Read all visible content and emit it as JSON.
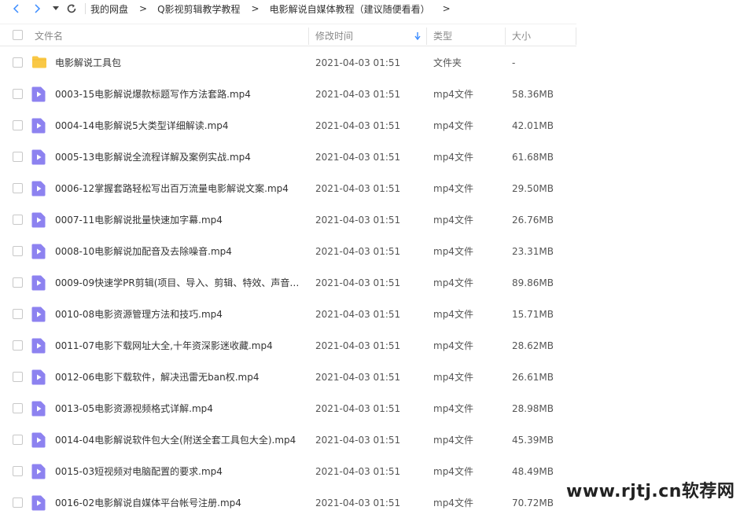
{
  "breadcrumb": [
    "我的网盘",
    "Q影视剪辑教学教程",
    "电影解说自媒体教程（建议随便看看）"
  ],
  "breadcrumb_trailing_arrow": ">",
  "breadcrumb_separator": ">",
  "columns": {
    "name": "文件名",
    "modified": "修改时间",
    "type": "类型",
    "size": "大小"
  },
  "sort": {
    "column": "modified",
    "direction": "desc",
    "color": "#3b8cff"
  },
  "colors": {
    "folder": "#f9c846",
    "video": "#8d82f0"
  },
  "files": [
    {
      "icon": "folder",
      "name": "电影解说工具包",
      "modified": "2021-04-03 01:51",
      "type": "文件夹",
      "size": "-"
    },
    {
      "icon": "video",
      "name": "0003-15电影解说爆款标题写作方法套路.mp4",
      "modified": "2021-04-03 01:51",
      "type": "mp4文件",
      "size": "58.36MB"
    },
    {
      "icon": "video",
      "name": "0004-14电影解说5大类型详细解读.mp4",
      "modified": "2021-04-03 01:51",
      "type": "mp4文件",
      "size": "42.01MB"
    },
    {
      "icon": "video",
      "name": "0005-13电影解说全流程详解及案例实战.mp4",
      "modified": "2021-04-03 01:51",
      "type": "mp4文件",
      "size": "61.68MB"
    },
    {
      "icon": "video",
      "name": "0006-12掌握套路轻松写出百万流量电影解说文案.mp4",
      "modified": "2021-04-03 01:51",
      "type": "mp4文件",
      "size": "29.50MB"
    },
    {
      "icon": "video",
      "name": "0007-11电影解说批量快速加字幕.mp4",
      "modified": "2021-04-03 01:51",
      "type": "mp4文件",
      "size": "26.76MB"
    },
    {
      "icon": "video",
      "name": "0008-10电影解说加配音及去除噪音.mp4",
      "modified": "2021-04-03 01:51",
      "type": "mp4文件",
      "size": "23.31MB"
    },
    {
      "icon": "video",
      "name": "0009-09快速学PR剪辑(项目、导入、剪辑、特效、声音…",
      "modified": "2021-04-03 01:51",
      "type": "mp4文件",
      "size": "89.86MB"
    },
    {
      "icon": "video",
      "name": "0010-08电影资源管理方法和技巧.mp4",
      "modified": "2021-04-03 01:51",
      "type": "mp4文件",
      "size": "15.71MB"
    },
    {
      "icon": "video",
      "name": "0011-07电影下载网址大全,十年资深影迷收藏.mp4",
      "modified": "2021-04-03 01:51",
      "type": "mp4文件",
      "size": "28.62MB"
    },
    {
      "icon": "video",
      "name": "0012-06电影下载软件，解决迅雷无ban权.mp4",
      "modified": "2021-04-03 01:51",
      "type": "mp4文件",
      "size": "26.61MB"
    },
    {
      "icon": "video",
      "name": "0013-05电影资源视频格式详解.mp4",
      "modified": "2021-04-03 01:51",
      "type": "mp4文件",
      "size": "28.98MB"
    },
    {
      "icon": "video",
      "name": "0014-04电影解说软件包大全(附送全套工具包大全).mp4",
      "modified": "2021-04-03 01:51",
      "type": "mp4文件",
      "size": "45.39MB"
    },
    {
      "icon": "video",
      "name": "0015-03短视频对电脑配置的要求.mp4",
      "modified": "2021-04-03 01:51",
      "type": "mp4文件",
      "size": "48.49MB"
    },
    {
      "icon": "video",
      "name": "0016-02电影解说自媒体平台帐号注册.mp4",
      "modified": "2021-04-03 01:51",
      "type": "mp4文件",
      "size": "70.72MB"
    }
  ],
  "watermark": "www.rjtj.cn软荐网"
}
